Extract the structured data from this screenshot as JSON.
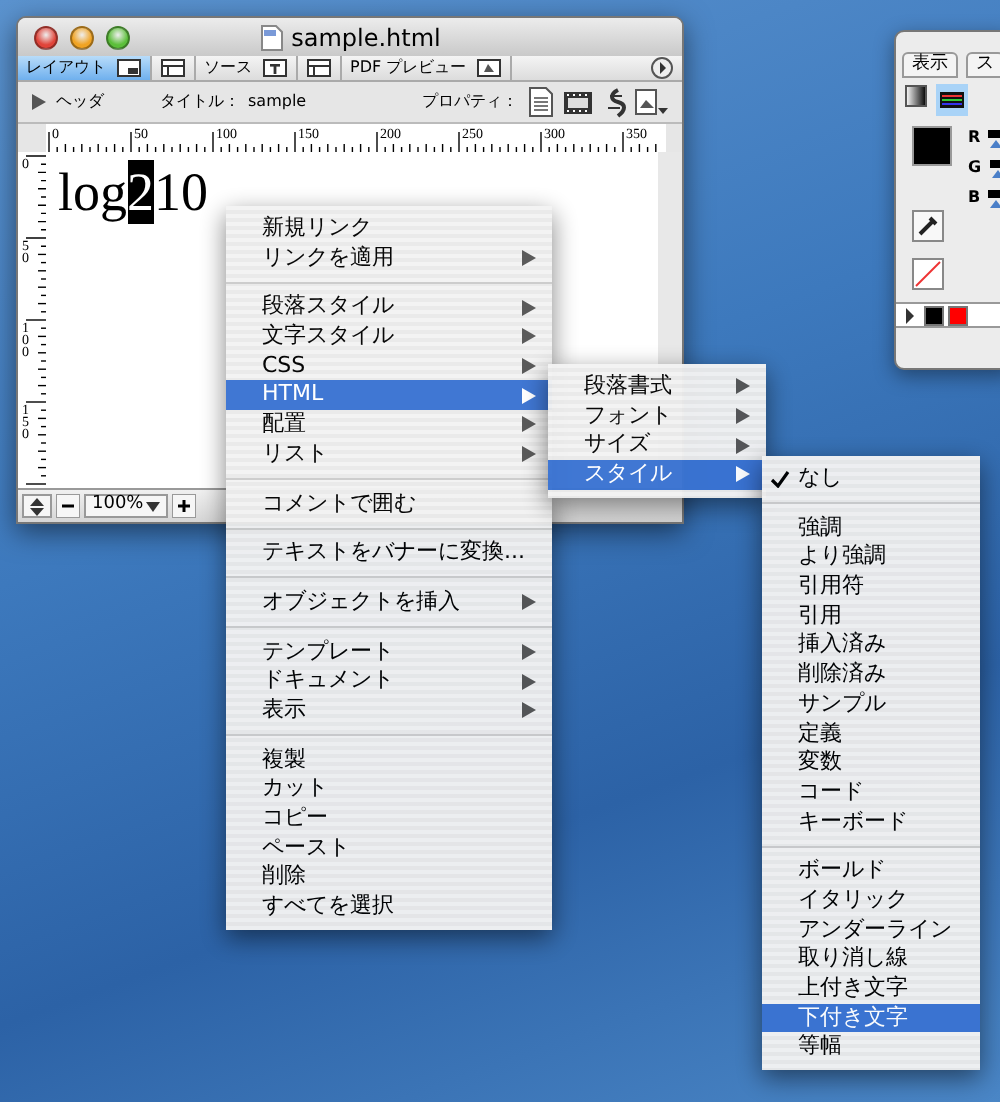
{
  "window": {
    "title": "sample.html",
    "tabs": [
      {
        "label": "レイアウト",
        "selected": true
      },
      {
        "label": "ソース",
        "selected": false
      },
      {
        "label": "PDF プレビュー",
        "selected": false
      }
    ],
    "toolbar": {
      "header_label": "ヘッダ",
      "title_label": "タイトル：",
      "title_value": "sample",
      "properties_label": "プロパティ："
    },
    "ruler": {
      "labels": [
        "0",
        "50",
        "100",
        "150",
        "200",
        "250",
        "300",
        "350"
      ],
      "vertical_labels": [
        "0",
        "50",
        "100",
        "150"
      ]
    },
    "document": {
      "text_before": "log",
      "selected_text": "2",
      "text_after": "10"
    },
    "zoom": "100%"
  },
  "palette": {
    "tabs": [
      {
        "label": "表示",
        "selected": false
      },
      {
        "label": "ス",
        "selected": false
      }
    ],
    "channels": [
      "R",
      "G",
      "B"
    ],
    "swatches": [
      {
        "color": "#000000"
      },
      {
        "color": "#ff0000"
      }
    ]
  },
  "context_menu": {
    "items": [
      {
        "kind": "item",
        "label": "新規リンク",
        "submenu": false,
        "selected": false
      },
      {
        "kind": "item",
        "label": "リンクを適用",
        "submenu": true,
        "selected": false
      },
      {
        "kind": "separator"
      },
      {
        "kind": "item",
        "label": "段落スタイル",
        "submenu": true,
        "selected": false
      },
      {
        "kind": "item",
        "label": "文字スタイル",
        "submenu": true,
        "selected": false
      },
      {
        "kind": "item",
        "label": "CSS",
        "submenu": true,
        "selected": false
      },
      {
        "kind": "item",
        "label": "HTML",
        "submenu": true,
        "selected": true,
        "items": [
          {
            "kind": "item",
            "label": "段落書式",
            "submenu": true,
            "selected": false
          },
          {
            "kind": "item",
            "label": "フォント",
            "submenu": true,
            "selected": false
          },
          {
            "kind": "item",
            "label": "サイズ",
            "submenu": true,
            "selected": false
          },
          {
            "kind": "item",
            "label": "スタイル",
            "submenu": true,
            "selected": true,
            "items": [
              {
                "kind": "item",
                "label": "なし",
                "checked": true,
                "selected": false
              },
              {
                "kind": "separator"
              },
              {
                "kind": "item",
                "label": "強調",
                "checked": false,
                "selected": false
              },
              {
                "kind": "item",
                "label": "より強調",
                "checked": false,
                "selected": false
              },
              {
                "kind": "item",
                "label": "引用符",
                "checked": false,
                "selected": false
              },
              {
                "kind": "item",
                "label": "引用",
                "checked": false,
                "selected": false
              },
              {
                "kind": "item",
                "label": "挿入済み",
                "checked": false,
                "selected": false
              },
              {
                "kind": "item",
                "label": "削除済み",
                "checked": false,
                "selected": false
              },
              {
                "kind": "item",
                "label": "サンプル",
                "checked": false,
                "selected": false
              },
              {
                "kind": "item",
                "label": "定義",
                "checked": false,
                "selected": false
              },
              {
                "kind": "item",
                "label": "変数",
                "checked": false,
                "selected": false
              },
              {
                "kind": "item",
                "label": "コード",
                "checked": false,
                "selected": false
              },
              {
                "kind": "item",
                "label": "キーボード",
                "checked": false,
                "selected": false
              },
              {
                "kind": "separator"
              },
              {
                "kind": "item",
                "label": "ボールド",
                "checked": false,
                "selected": false
              },
              {
                "kind": "item",
                "label": "イタリック",
                "checked": false,
                "selected": false
              },
              {
                "kind": "item",
                "label": "アンダーライン",
                "checked": false,
                "selected": false
              },
              {
                "kind": "item",
                "label": "取り消し線",
                "checked": false,
                "selected": false
              },
              {
                "kind": "item",
                "label": "上付き文字",
                "checked": false,
                "selected": false
              },
              {
                "kind": "item",
                "label": "下付き文字",
                "checked": false,
                "selected": true
              },
              {
                "kind": "item",
                "label": "等幅",
                "checked": false,
                "selected": false
              }
            ]
          }
        ]
      },
      {
        "kind": "item",
        "label": "配置",
        "submenu": true,
        "selected": false
      },
      {
        "kind": "item",
        "label": "リスト",
        "submenu": true,
        "selected": false
      },
      {
        "kind": "separator"
      },
      {
        "kind": "item",
        "label": "コメントで囲む",
        "submenu": false,
        "selected": false
      },
      {
        "kind": "separator"
      },
      {
        "kind": "item",
        "label": "テキストをバナーに変換...",
        "submenu": false,
        "selected": false
      },
      {
        "kind": "separator"
      },
      {
        "kind": "item",
        "label": "オブジェクトを挿入",
        "submenu": true,
        "selected": false
      },
      {
        "kind": "separator"
      },
      {
        "kind": "item",
        "label": "テンプレート",
        "submenu": true,
        "selected": false
      },
      {
        "kind": "item",
        "label": "ドキュメント",
        "submenu": true,
        "selected": false
      },
      {
        "kind": "item",
        "label": "表示",
        "submenu": true,
        "selected": false
      },
      {
        "kind": "separator"
      },
      {
        "kind": "item",
        "label": "複製",
        "submenu": false,
        "selected": false
      },
      {
        "kind": "item",
        "label": "カット",
        "submenu": false,
        "selected": false
      },
      {
        "kind": "item",
        "label": "コピー",
        "submenu": false,
        "selected": false
      },
      {
        "kind": "item",
        "label": "ペースト",
        "submenu": false,
        "selected": false
      },
      {
        "kind": "item",
        "label": "削除",
        "submenu": false,
        "selected": false
      },
      {
        "kind": "item",
        "label": "すべてを選択",
        "submenu": false,
        "selected": false
      }
    ]
  }
}
